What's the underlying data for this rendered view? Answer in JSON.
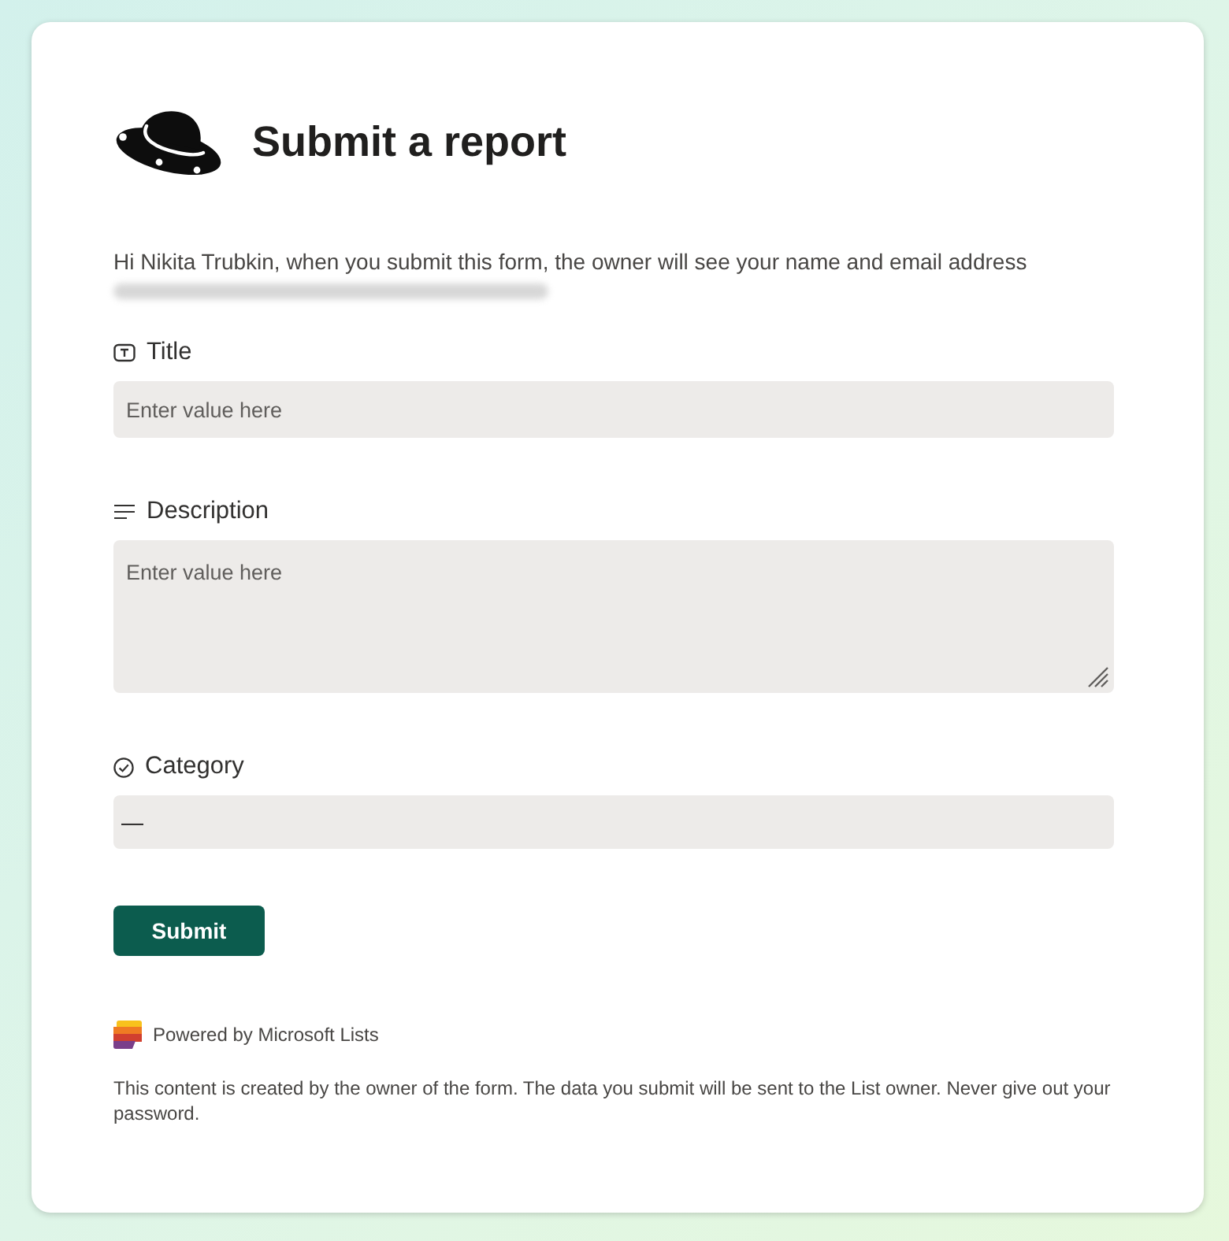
{
  "header": {
    "title": "Submit a report"
  },
  "intro": {
    "text": "Hi Nikita Trubkin, when you submit this form, the owner will see your name and email address"
  },
  "fields": [
    {
      "kind": "text",
      "label": "Title",
      "placeholder": "Enter value here"
    },
    {
      "kind": "multiline",
      "label": "Description",
      "placeholder": "Enter value here"
    },
    {
      "kind": "choice",
      "label": "Category",
      "value": "—"
    }
  ],
  "submit_button": {
    "label": "Submit"
  },
  "footer": {
    "powered_by": "Powered by Microsoft Lists",
    "notice": "This content is created by the owner of the form. The data you submit will be sent to the List owner. Never give out your password."
  }
}
